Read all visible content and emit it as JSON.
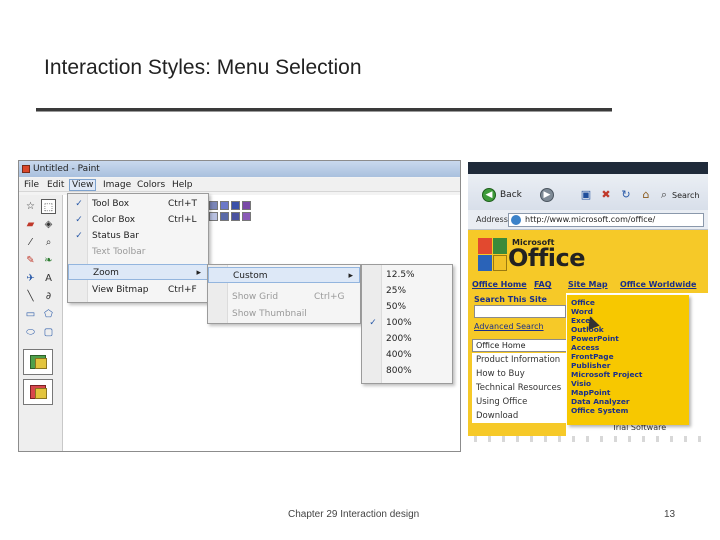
{
  "slide": {
    "title": "Interaction Styles: Menu Selection",
    "footer_center": "Chapter 29 Interaction design",
    "page_number": "13"
  },
  "paint": {
    "window_title": "Untitled - Paint",
    "menubar": [
      "File",
      "Edit",
      "View",
      "Image",
      "Colors",
      "Help"
    ],
    "active_menu": "View",
    "view_menu": [
      {
        "label": "Tool Box",
        "shortcut": "Ctrl+T",
        "checked": true
      },
      {
        "label": "Color Box",
        "shortcut": "Ctrl+L",
        "checked": true
      },
      {
        "label": "Status Bar",
        "shortcut": "",
        "checked": true
      },
      {
        "label": "Text Toolbar",
        "shortcut": "",
        "disabled": true
      },
      {
        "label": "Zoom",
        "shortcut": "",
        "submenu": true,
        "highlighted": true
      },
      {
        "label": "View Bitmap",
        "shortcut": "Ctrl+F"
      }
    ],
    "zoom_menu": [
      {
        "label": "Custom",
        "shortcut": "",
        "submenu": true,
        "highlighted": true
      },
      {
        "label": "Show Grid",
        "shortcut": "Ctrl+G",
        "disabled": true
      },
      {
        "label": "Show Thumbnail",
        "shortcut": "",
        "disabled": true
      }
    ],
    "custom_menu": [
      {
        "label": "12.5%"
      },
      {
        "label": "25%"
      },
      {
        "label": "50%"
      },
      {
        "label": "100%",
        "checked": true
      },
      {
        "label": "200%"
      },
      {
        "label": "400%"
      },
      {
        "label": "800%"
      }
    ],
    "palette_colors": [
      "#7b86b8",
      "#6b78c8",
      "#3a50a8",
      "#7a4aa8",
      "#b8c0e0",
      "#5a6aa8",
      "#4a52a0",
      "#8a5ab8"
    ]
  },
  "browser": {
    "back_label": "Back",
    "search_label": "Search",
    "address_label": "Address",
    "url": "http://www.microsoft.com/office/",
    "brand_small": "Microsoft",
    "brand": "Office",
    "nav": [
      "Office Home",
      "FAQ",
      "Site Map",
      "Office Worldwide"
    ],
    "search_title": "Search This Site",
    "advanced_search": "Advanced Search",
    "select_value": "Office Home",
    "left_links": [
      "Product Information",
      "How to Buy",
      "Technical Resources",
      "Using Office",
      "Download"
    ],
    "dropdown_items": [
      "Office",
      "Word",
      "Excel",
      "Outlook",
      "PowerPoint",
      "Access",
      "FrontPage",
      "Publisher",
      "Microsoft Project",
      "Visio",
      "MapPoint",
      "Data Analyzer",
      "Office System"
    ],
    "right_text": [
      "Trial Software"
    ]
  }
}
